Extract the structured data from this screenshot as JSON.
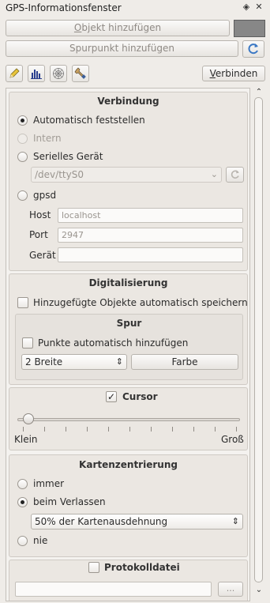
{
  "window": {
    "title": "GPS-Informationsfenster"
  },
  "toolbar": {
    "add_feature_label": "Objekt hinzufügen",
    "add_feature_mnemonic": "O",
    "add_feature_rest": "bjekt hinzufügen",
    "add_vertex_label": "Spurpunkt hinzufügen",
    "connect_label": "Verbinden",
    "connect_mnemonic": "V",
    "connect_rest": "erbinden",
    "track_color": "#878787"
  },
  "connection": {
    "title": "Verbindung",
    "auto_label": "Automatisch feststellen",
    "internal_label": "Intern",
    "serial_label": "Serielles Gerät",
    "serial_port": "/dev/ttyS0",
    "gpsd_label": "gpsd",
    "host_label": "Host",
    "host_placeholder": "localhost",
    "port_label": "Port",
    "port_placeholder": "2947",
    "device_label": "Gerät",
    "device_value": ""
  },
  "digitizing": {
    "title": "Digitalisierung",
    "autosave_label": "Hinzugefügte Objekte automatisch speichern",
    "track": {
      "title": "Spur",
      "auto_add_label": "Punkte automatisch hinzufügen",
      "width_value": "2 Breite",
      "color_button": "Farbe"
    }
  },
  "cursor": {
    "title": "Cursor",
    "checked": true,
    "min_label": "Klein",
    "max_label": "Groß",
    "slider_value": 0.05
  },
  "map_centering": {
    "title": "Kartenzentrierung",
    "always_label": "immer",
    "on_leave_label": "beim Verlassen",
    "extent_value": "50% der Kartenausdehnung",
    "never_label": "nie"
  },
  "log_file": {
    "title": "Protokolldatei",
    "path_value": "",
    "browse_label": "..."
  },
  "colors": {
    "accent": "#3b78c4"
  }
}
